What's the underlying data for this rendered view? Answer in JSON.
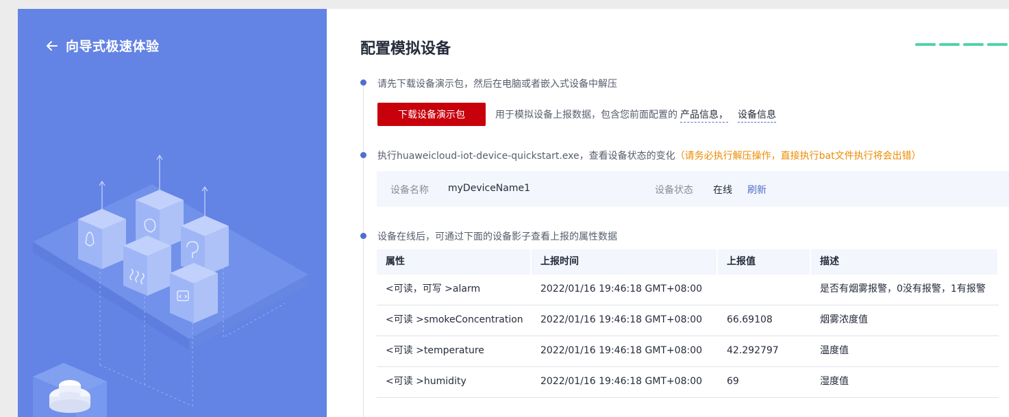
{
  "sidebar": {
    "back_title": "向导式极速体验"
  },
  "main": {
    "title": "配置模拟设备",
    "progress_steps": 4,
    "step1": {
      "text": "请先下载设备演示包，然后在电脑或者嵌入式设备中解压",
      "download_button": "下载设备演示包",
      "description": "用于模拟设备上报数据，包含您前面配置的",
      "link_product": "产品信息，",
      "link_device": "设备信息"
    },
    "step2": {
      "text": "执行huaweicloud-iot-device-quickstart.exe，查看设备状态的变化",
      "warning": "（请务必执行解压操作，直接执行bat文件执行将会出错）",
      "device_name_label": "设备名称",
      "device_name_value": "myDeviceName1",
      "device_status_label": "设备状态",
      "device_status_value": "在线",
      "refresh_label": "刷新"
    },
    "step3": {
      "text": "设备在线后，可通过下面的设备影子查看上报的属性数据"
    },
    "table": {
      "headers": [
        "属性",
        "上报时间",
        "上报值",
        "描述"
      ],
      "rows": [
        [
          "<可读，可写 >alarm",
          "2022/01/16 19:46:18 GMT+08:00",
          "",
          "是否有烟雾报警，0没有报警，1有报警"
        ],
        [
          "<可读 >smokeConcentration",
          "2022/01/16 19:46:18 GMT+08:00",
          "66.69108",
          "烟雾浓度值"
        ],
        [
          "<可读 >temperature",
          "2022/01/16 19:46:18 GMT+08:00",
          "42.292797",
          "温度值"
        ],
        [
          "<可读 >humidity",
          "2022/01/16 19:46:18 GMT+08:00",
          "69",
          "湿度值"
        ]
      ]
    }
  },
  "colors": {
    "sidebar_bg": "#6383e5",
    "primary_button": "#c7000b",
    "link": "#526ecc",
    "warning": "#ed8b00",
    "progress": "#4fd4a4"
  }
}
